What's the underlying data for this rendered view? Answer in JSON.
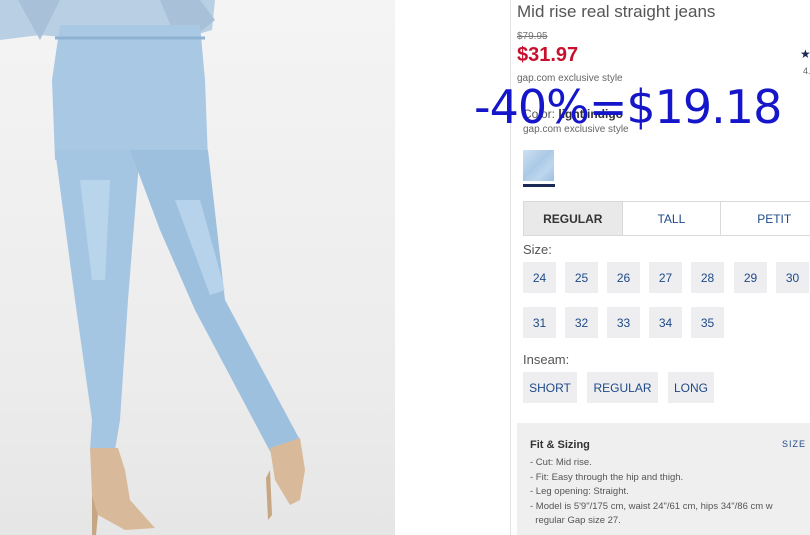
{
  "product": {
    "title": "Mid rise real straight jeans",
    "original_price": "$79.95",
    "sale_price": "$31.97",
    "exclusive_note": "gap.com exclusive style",
    "rating_star": "★",
    "rating_value": "4."
  },
  "color": {
    "label": "Color:",
    "value": "light indigo",
    "exclusive_note": "gap.com exclusive style"
  },
  "fit_tabs": [
    {
      "label": "REGULAR",
      "active": true
    },
    {
      "label": "TALL",
      "active": false
    },
    {
      "label": "PETIT",
      "active": false
    }
  ],
  "size": {
    "label": "Size:",
    "row1": [
      "24",
      "25",
      "26",
      "27",
      "28",
      "29",
      "30"
    ],
    "row2": [
      "31",
      "32",
      "33",
      "34",
      "35"
    ]
  },
  "inseam": {
    "label": "Inseam:",
    "options": [
      "SHORT",
      "REGULAR",
      "LONG"
    ]
  },
  "fit_sizing": {
    "title": "Fit & Sizing",
    "size_link": "SIZE",
    "items": [
      "- Cut: Mid rise.",
      "- Fit: Easy through the hip and thigh.",
      "- Leg opening: Straight.",
      "- Model is 5'9\"/175 cm, waist 24\"/61 cm, hips 34\"/86 cm w",
      "  regular Gap size 27."
    ]
  },
  "overlay_annotation": "-40%=$19.18",
  "colors": {
    "sale_red": "#c8102e",
    "link_blue": "#1e4a87",
    "overlay_blue": "#1515c9",
    "chip_bg": "#eeeef0"
  }
}
